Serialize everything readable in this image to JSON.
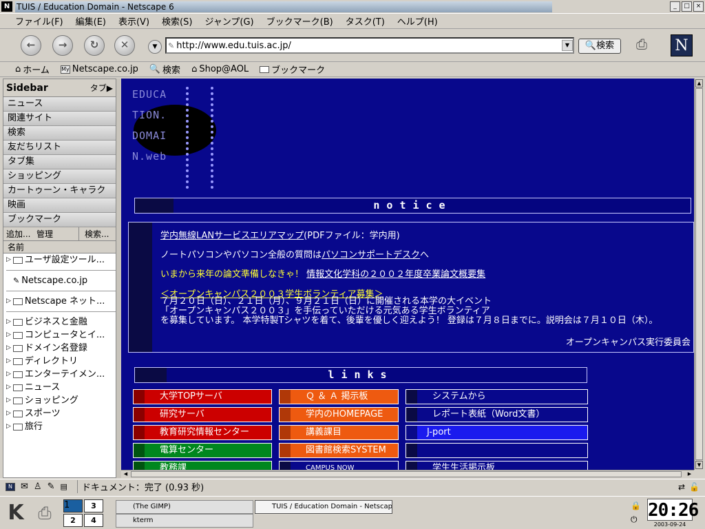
{
  "window": {
    "app_icon": "N",
    "title": "TUIS / Education Domain - Netscape 6",
    "controls": [
      "_",
      "□",
      "×"
    ]
  },
  "menu": [
    "ファイル(F)",
    "編集(E)",
    "表示(V)",
    "検索(S)",
    "ジャンプ(G)",
    "ブックマーク(B)",
    "タスク(T)",
    "ヘルプ(H)"
  ],
  "nav": {
    "url": "http://www.edu.tuis.ac.jp/",
    "search_label": "検索",
    "logo": "N"
  },
  "personal": {
    "items": [
      "ホーム",
      "Netscape.co.jp",
      "検索",
      "Shop@AOL",
      "ブックマーク"
    ],
    "my_badge": "My"
  },
  "sidebar": {
    "title": "Sidebar",
    "tab_menu": "タブ▶",
    "tabs": [
      "ニュース",
      "関連サイト",
      "検索",
      "友だちリスト",
      "タブ集",
      "ショッピング",
      "カートゥーン・キャラク",
      "映画",
      "ブックマーク"
    ],
    "tools": [
      "追加...",
      "管理",
      "検索..."
    ],
    "column": "名前",
    "tree": {
      "user_folder": "ユーザ設定ツール...",
      "netscape_jp": "Netscape.co.jp",
      "netscape_net": "Netscape ネット...",
      "folders": [
        "ビジネスと金融",
        "コンピュータとイ...",
        "ドメイン名登録",
        "ディレクトリ",
        "エンターテイメン...",
        "ニュース",
        "ショッピング",
        "スポーツ",
        "旅行"
      ]
    }
  },
  "page": {
    "logo_lines": [
      "EDUCA",
      "TION.",
      "DOMAI",
      "N.web"
    ],
    "notice_header": "notice",
    "notices": {
      "l1_link": "学内無線LANサービスエリアマップ",
      "l1_rest": "(PDFファイル：学内用)",
      "l2_pre": "ノートパソコンやパソコン全般の質問は",
      "l2_link": "パソコンサポートデスク",
      "l2_post": "へ",
      "l3_pre": "いまから来年の論文準備しなきゃ！",
      "l3_link": "情報文化学科の２００２年度卒業論文概要集",
      "l4_link": "＜オープンキャンパス２００３学生ボランティア募集＞",
      "l5": "７月２０日（日）、２１日（月）、９月２１日（日）に開催される本学の大イベント",
      "l6": "「オープンキャンパス２００３」を手伝っていただける元気ある学生ボランティア",
      "l7": "を募集しています。 本学特製Tシャツを着て、後輩を優しく迎えよう！ 登録は７月８日までに。説明会は７月１０日（木）。",
      "signature": "オープンキャンパス実行委員会"
    },
    "links_header": "links",
    "links": {
      "col1": [
        "大学TOPサーバ",
        "研究サーバ",
        "教育研究情報センター",
        "電算センター",
        "教務課"
      ],
      "col2": [
        "Ｑ ＆ Ａ 掲示板",
        "学内のHOMEPAGE",
        "講義課目",
        "図書館検索SYSTEM",
        "CAMPUS NOW"
      ],
      "col3": [
        "システムから",
        "レポート表紙（Word文書）",
        "J-port",
        "",
        "学生生活掲示板"
      ]
    }
  },
  "status": {
    "text": "ドキュメント：完了 (0.93 秒)"
  },
  "taskbar": {
    "desktops": [
      "1",
      "2",
      "3",
      "4"
    ],
    "tasks": [
      "(The GIMP)",
      "kterm",
      "TUIS / Education Domain - Netscape 6"
    ],
    "clock": "20:26",
    "date": "2003-09-24"
  },
  "colors": {
    "page_bg": "#08088c",
    "red": "#cc0000",
    "orange": "#ee5a10",
    "green": "#00871e",
    "blue": "#1a1acc",
    "link_yellow": "#ffff33"
  }
}
